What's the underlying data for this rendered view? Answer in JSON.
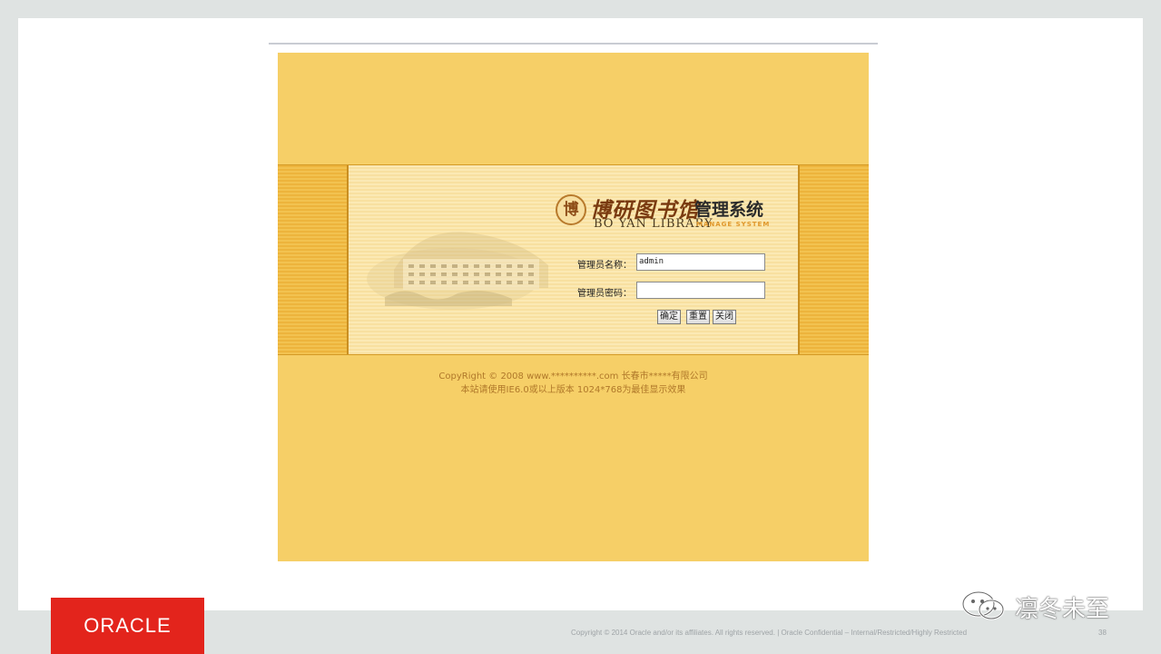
{
  "logo": {
    "seal_char": "博",
    "cn_title": "博研图书馆",
    "cn_subtitle": "管理系统",
    "en_title": "BO YAN LIBRARY",
    "en_subtitle": "MANAGE SYSTEM"
  },
  "form": {
    "username_label": "管理员名称：",
    "username_value": "admin",
    "password_label": "管理员密码：",
    "password_value": "",
    "confirm_button": "确定",
    "reset_button": "重置",
    "close_button": "关闭"
  },
  "copyright": {
    "line1": "CopyRight © 2008 www.**********.com 长春市*****有限公司",
    "line2": "本站请使用IE6.0或以上版本 1024*768为最佳显示效果"
  },
  "slide_footer": {
    "brand": "ORACLE",
    "copyright": "Copyright © 2014 Oracle and/or its affiliates. All rights reserved.  |  Oracle Confidential – Internal/Restricted/Highly Restricted",
    "page_number": "38"
  },
  "watermark": {
    "text": "凛冬未至",
    "icon": "wechat-icon"
  },
  "colors": {
    "page_bg": "#f6cf67",
    "band": "#edb43c",
    "panel": "#fbe9b4",
    "oracle_red": "#e3241c",
    "copyright_text": "#b0782a"
  }
}
